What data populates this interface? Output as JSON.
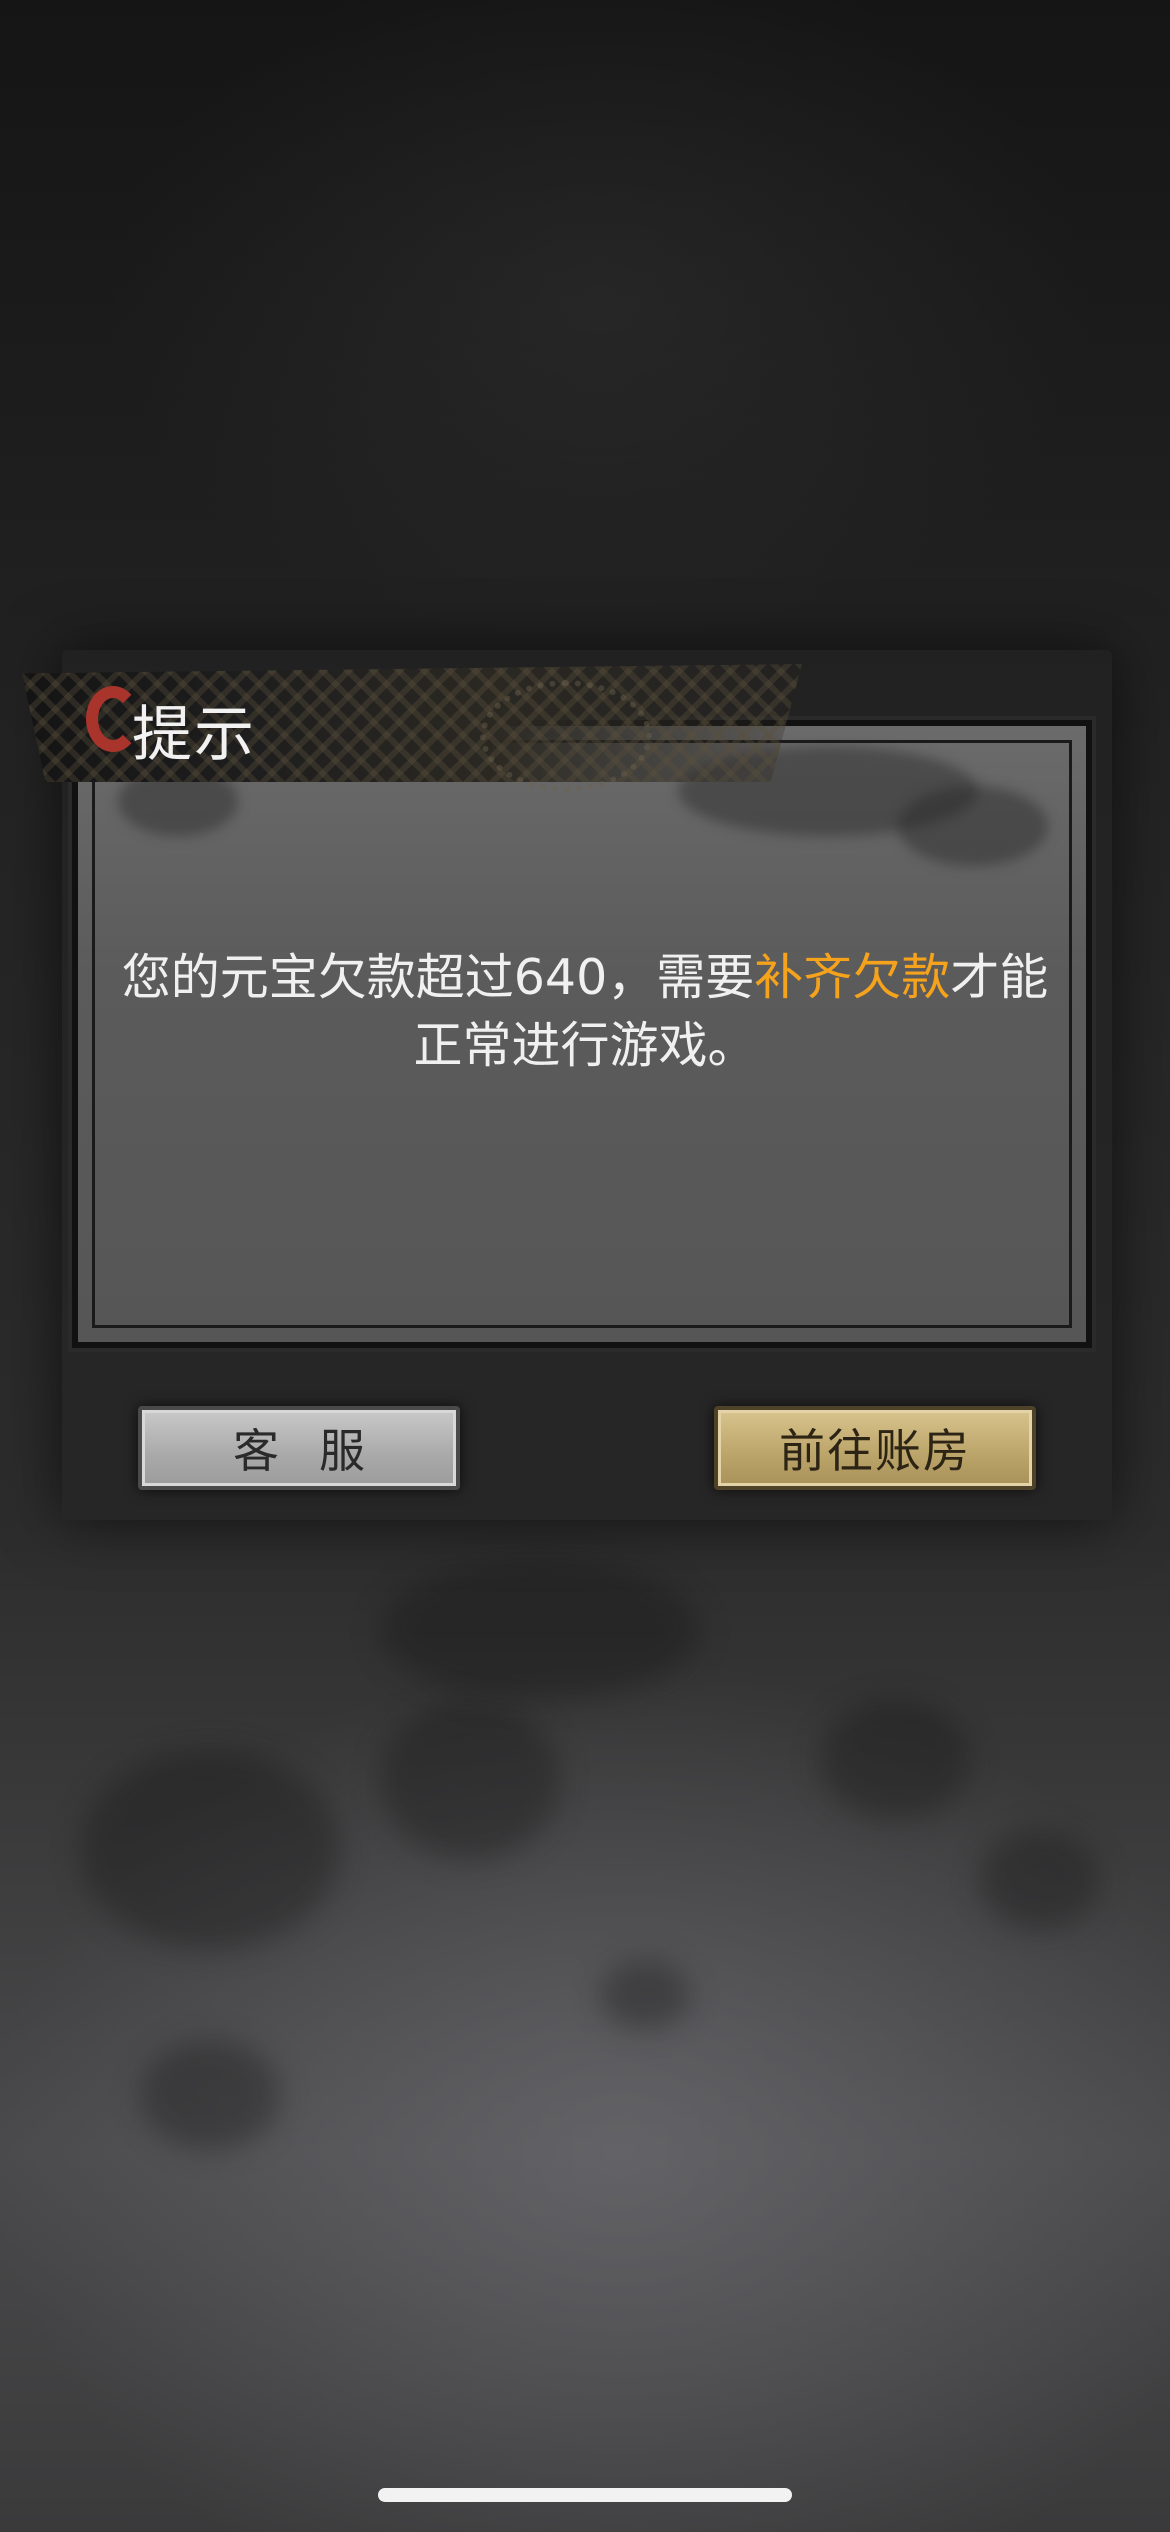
{
  "dialog": {
    "title": "提示",
    "message_before": "您的元宝欠款超过640，需要",
    "message_highlight": "补齐欠款",
    "message_after": "才能正常进行游戏。",
    "highlight_color": "#f5a21c"
  },
  "buttons": {
    "service_label": "客服",
    "ledger_label": "前往账房"
  },
  "icons": {
    "title_ornament": "red-ink-ring-icon"
  }
}
